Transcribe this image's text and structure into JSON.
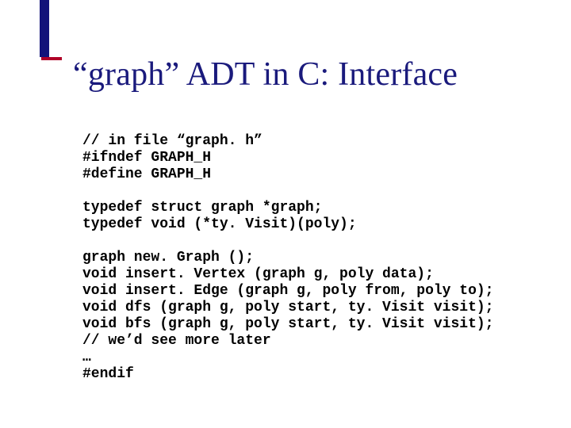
{
  "title": "“graph” ADT in C: Interface",
  "code": {
    "l1": "// in file “graph. h”",
    "l2": "#ifndef GRAPH_H",
    "l3": "#define GRAPH_H",
    "l4": "",
    "l5": "typedef struct graph *graph;",
    "l6": "typedef void (*ty. Visit)(poly);",
    "l7": "",
    "l8": "graph new. Graph ();",
    "l9": "void insert. Vertex (graph g, poly data);",
    "l10": "void insert. Edge (graph g, poly from, poly to);",
    "l11": "void dfs (graph g, poly start, ty. Visit visit);",
    "l12": "void bfs (graph g, poly start, ty. Visit visit);",
    "l13": "// we’d see more later",
    "l14": "…",
    "l15": "#endif"
  }
}
